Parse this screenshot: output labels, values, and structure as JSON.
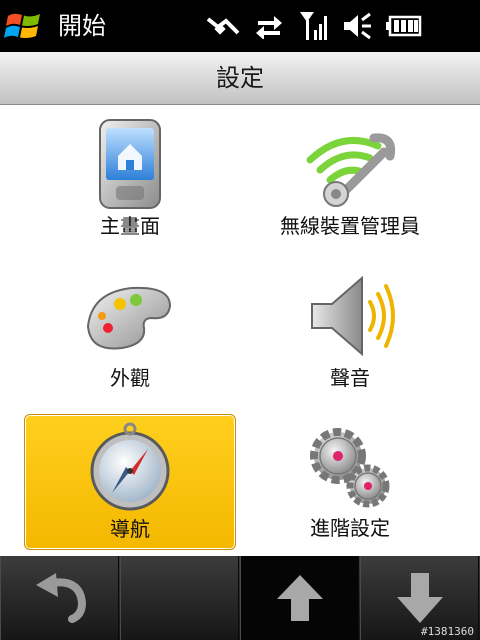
{
  "statusbar": {
    "start_label": "開始",
    "icons": [
      "connectivity-icon",
      "data-transfer-icon",
      "signal-strength-icon",
      "speaker-muted-icon",
      "battery-icon"
    ]
  },
  "titlebar": {
    "title": "設定"
  },
  "tiles": [
    {
      "label": "主畫面",
      "icon": "home-screen-icon",
      "selected": false
    },
    {
      "label": "無線裝置管理員",
      "icon": "wireless-manager-icon",
      "selected": false
    },
    {
      "label": "外觀",
      "icon": "palette-icon",
      "selected": false
    },
    {
      "label": "聲音",
      "icon": "speaker-icon",
      "selected": false
    },
    {
      "label": "導航",
      "icon": "compass-icon",
      "selected": true
    },
    {
      "label": "進階設定",
      "icon": "gears-icon",
      "selected": false
    }
  ],
  "bottombar": {
    "keys": [
      "back-icon",
      "",
      "up-arrow-icon",
      "down-arrow-icon"
    ],
    "watermark": "#1381360"
  },
  "colors": {
    "selection": "#f4b800",
    "statusbar": "#000000"
  }
}
